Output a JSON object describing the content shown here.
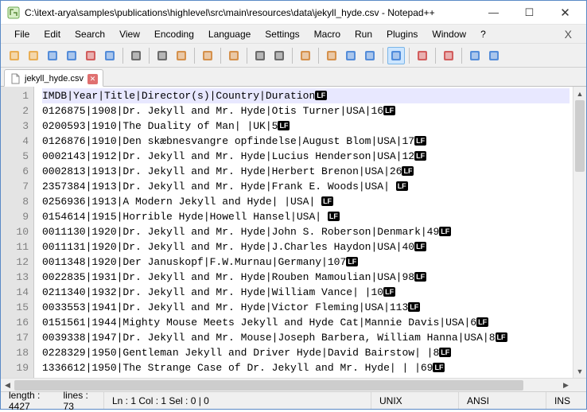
{
  "window": {
    "title": "C:\\itext-arya\\samples\\publications\\highlevel\\src\\main\\resources\\data\\jekyll_hyde.csv - Notepad++"
  },
  "menu": [
    "File",
    "Edit",
    "Search",
    "View",
    "Encoding",
    "Language",
    "Settings",
    "Macro",
    "Run",
    "Plugins",
    "Window",
    "?"
  ],
  "tab": {
    "label": "jekyll_hyde.csv"
  },
  "lines": [
    "IMDB|Year|Title|Director(s)|Country|Duration",
    "0126875|1908|Dr. Jekyll and Mr. Hyde|Otis Turner|USA|16",
    "0200593|1910|The Duality of Man| |UK|5",
    "0126876|1910|Den skæbnesvangre opfindelse|August Blom|USA|17",
    "0002143|1912|Dr. Jekyll and Mr. Hyde|Lucius Henderson|USA|12",
    "0002813|1913|Dr. Jekyll and Mr. Hyde|Herbert Brenon|USA|26",
    "2357384|1913|Dr. Jekyll and Mr. Hyde|Frank E. Woods|USA| ",
    "0256936|1913|A Modern Jekyll and Hyde| |USA| ",
    "0154614|1915|Horrible Hyde|Howell Hansel|USA| ",
    "0011130|1920|Dr. Jekyll and Mr. Hyde|John S. Roberson|Denmark|49",
    "0011131|1920|Dr. Jekyll and Mr. Hyde|J.Charles Haydon|USA|40",
    "0011348|1920|Der Januskopf|F.W.Murnau|Germany|107",
    "0022835|1931|Dr. Jekyll and Mr. Hyde|Rouben Mamoulian|USA|98",
    "0211340|1932|Dr. Jekyll and Mr. Hyde|William Vance| |10",
    "0033553|1941|Dr. Jekyll and Mr. Hyde|Victor Fleming|USA|113",
    "0151561|1944|Mighty Mouse Meets Jekyll and Hyde Cat|Mannie Davis|USA|6",
    "0039338|1947|Dr. Jekyll and Mr. Mouse|Joseph Barbera, William Hanna|USA|8",
    "0228329|1950|Gentleman Jekyll and Driver Hyde|David Bairstow| |8",
    "1336612|1950|The Strange Case of Dr. Jekyll and Mr. Hyde| | |69"
  ],
  "status": {
    "length_label": "length : 4427",
    "lines_label": "lines : 73",
    "cursor": "Ln : 1   Col : 1   Sel : 0 | 0",
    "eol": "UNIX",
    "enc": "ANSI",
    "ins": "INS"
  },
  "colors": {
    "toolbar_icons": [
      "#e8a23a",
      "#e8a23a",
      "#3a7bd5",
      "#3a7bd5",
      "#c44",
      "#3a7bd5",
      "#555",
      "#555",
      "#d08030",
      "#d08030",
      "#d08030",
      "#555",
      "#555",
      "#d08030",
      "#d08030",
      "#3a7bd5",
      "#3a7bd5",
      "#3a7bd5",
      "#c44",
      "#c44",
      "#3a7bd5",
      "#3a7bd5",
      "#3a7bd5",
      "#3a7bd5",
      "#3a90c9",
      "#3a90c9",
      "#6aa84f",
      "#d08030",
      "#3a7bd5",
      "#d9a84e",
      "#c44",
      "#6aa84f"
    ]
  }
}
